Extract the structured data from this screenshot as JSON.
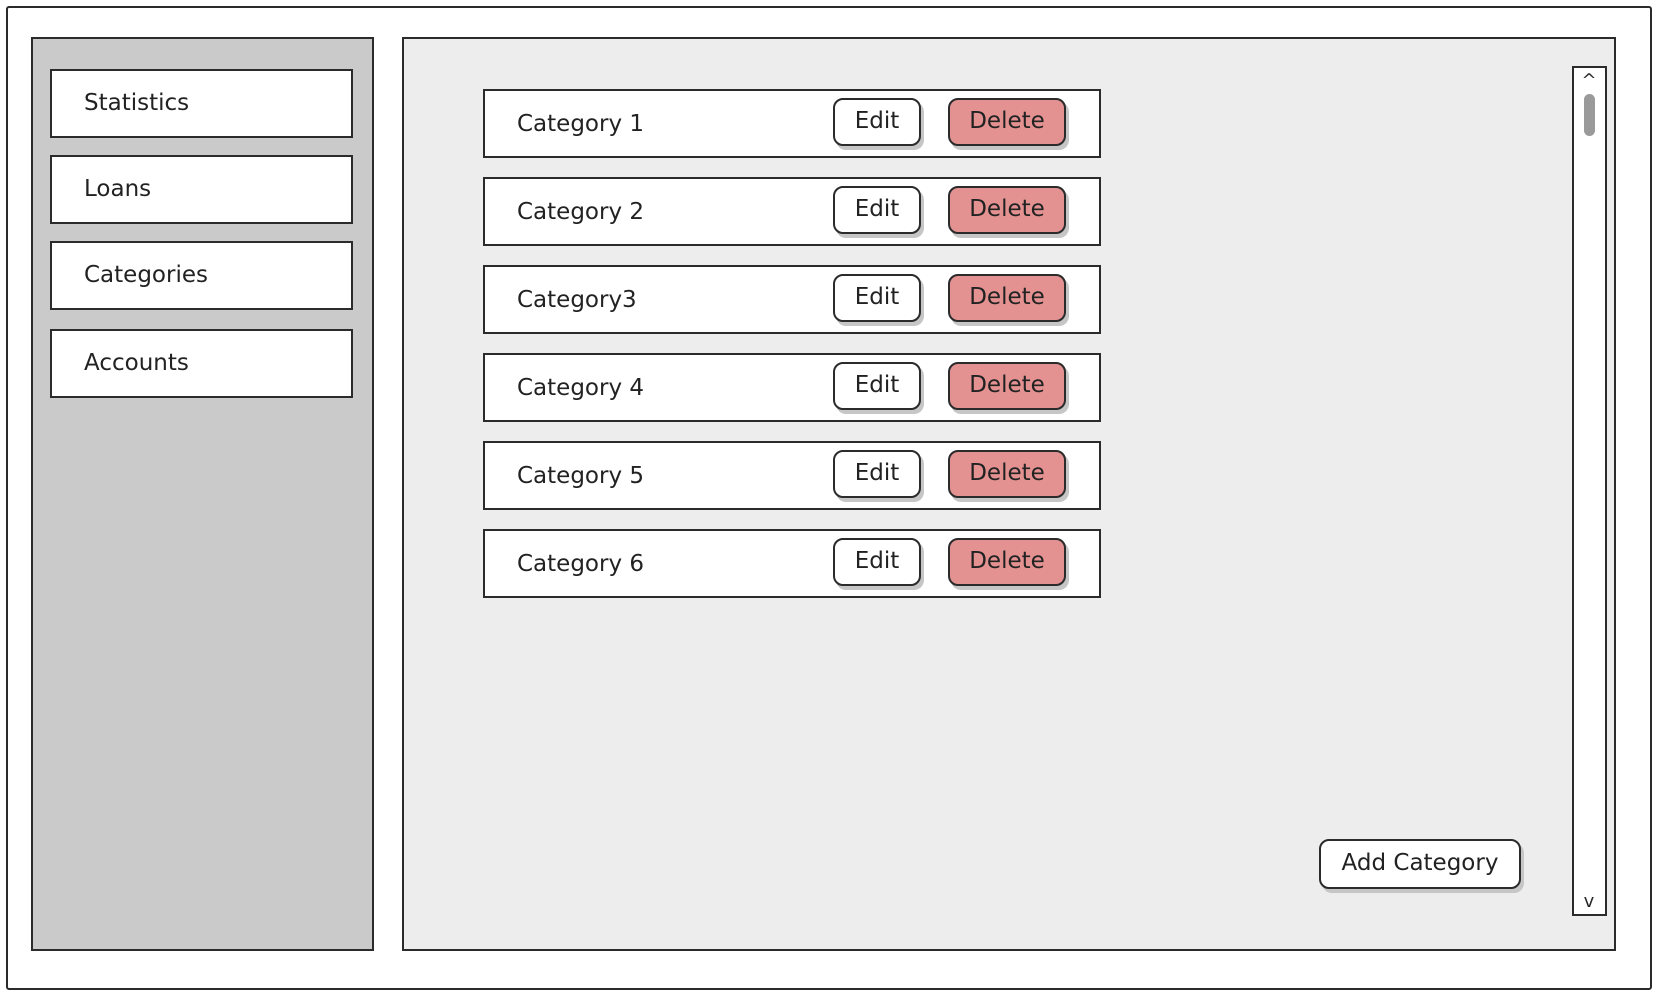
{
  "sidebar": {
    "items": [
      {
        "label": "Statistics"
      },
      {
        "label": "Loans"
      },
      {
        "label": "Categories"
      },
      {
        "label": "Accounts"
      }
    ]
  },
  "categories": {
    "edit_label": "Edit",
    "delete_label": "Delete",
    "items": [
      {
        "label": "Category 1"
      },
      {
        "label": "Category 2"
      },
      {
        "label": "Category3"
      },
      {
        "label": "Category 4"
      },
      {
        "label": "Category 5"
      },
      {
        "label": "Category 6"
      }
    ]
  },
  "actions": {
    "add_label": "Add Category"
  },
  "scrollbar": {
    "up_icon": "^",
    "down_icon": "v"
  },
  "colors": {
    "sidebar_bg": "#cacaca",
    "main_bg": "#ededed",
    "delete_bg": "#e39191"
  }
}
